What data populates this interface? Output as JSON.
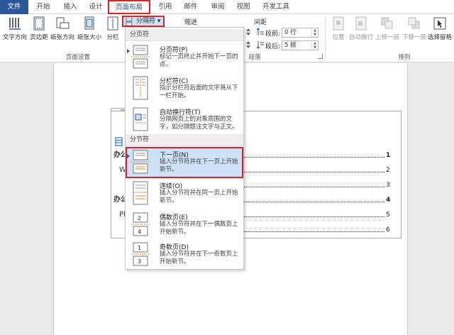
{
  "tabs": [
    {
      "label": "文件",
      "name": "tab-file"
    },
    {
      "label": "开始",
      "name": "tab-home"
    },
    {
      "label": "插入",
      "name": "tab-insert"
    },
    {
      "label": "设计",
      "name": "tab-design"
    },
    {
      "label": "页面布局",
      "name": "tab-page-layout"
    },
    {
      "label": "引用",
      "name": "tab-references"
    },
    {
      "label": "邮件",
      "name": "tab-mailings"
    },
    {
      "label": "审阅",
      "name": "tab-review"
    },
    {
      "label": "视图",
      "name": "tab-view"
    },
    {
      "label": "开发工具",
      "name": "tab-developer"
    }
  ],
  "ribbon": {
    "text_direction": "文字方向",
    "margins": "页边距",
    "orientation": "纸张方向",
    "size": "纸张大小",
    "columns": "分栏",
    "page_setup_label": "页面设置",
    "breaks": "分隔符",
    "indent": "缩进",
    "spacing": "间距",
    "before_label": "段前:",
    "before_value": "0 行",
    "after_label": "段后:",
    "after_value": "5 磅",
    "paragraph_label": "段落",
    "position": "位置",
    "wrap": "自动换行",
    "bring_forward": "上移一层",
    "send_backward": "下移一层",
    "selection_pane": "选择窗格",
    "arrange_label": "排列"
  },
  "dropdown": {
    "section1": "分页符",
    "section2": "分节符",
    "items": [
      {
        "title": "分页符(P)",
        "desc": "标记一页终止并开始下一页的点。"
      },
      {
        "title": "分栏符(C)",
        "desc": "指示分栏符后面的文字将从下一栏开始。"
      },
      {
        "title": "自动换行符(T)",
        "desc": "分隔网页上的对象周围的文字，如分隔题注文字与正文。"
      },
      {
        "title": "下一页(N)",
        "desc": "插入分节符并在下一页上开始新节。"
      },
      {
        "title": "连续(O)",
        "desc": "插入分节符并在同一页上开始新节。"
      },
      {
        "title": "偶数页(E)",
        "desc": "插入分节符并在下一偶数页上开始新节。"
      },
      {
        "title": "奇数页(D)",
        "desc": "插入分节符并在下一奇数页上开始新节。"
      }
    ]
  },
  "document": {
    "toc_title": "目",
    "toc_lines": [
      {
        "text": "办公",
        "num": "1"
      },
      {
        "text": "W",
        "num": "2"
      },
      {
        "text": "",
        "num": "3"
      },
      {
        "text": "办公",
        "num": "4"
      },
      {
        "text": "Pl",
        "num": "5"
      },
      {
        "text": "",
        "num": "6"
      }
    ]
  },
  "colors": {
    "accent": "#2b579a",
    "highlight": "#d9242b",
    "selected_bg": "#cfe1f7"
  }
}
